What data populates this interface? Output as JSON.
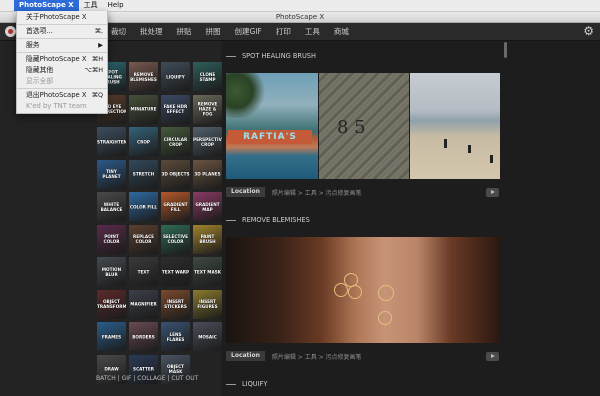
{
  "menubar": {
    "app": "PhotoScape X",
    "items": [
      "工具",
      "Help"
    ]
  },
  "window_title": "PhotoScape X",
  "toolbar": {
    "tabs": [
      "裁切",
      "批处理",
      "拼贴",
      "拼图",
      "创建GIF",
      "打印",
      "工具",
      "商城"
    ]
  },
  "app_menu": {
    "items": [
      {
        "label": "关于PhotoScape X",
        "shortcut": ""
      },
      {
        "label": "首选项...",
        "shortcut": "⌘,"
      },
      {
        "label": "服务",
        "shortcut": "▶"
      },
      {
        "label": "隐藏PhotoScape X",
        "shortcut": "⌘H"
      },
      {
        "label": "隐藏其他",
        "shortcut": "⌥⌘H"
      },
      {
        "label": "显示全部",
        "shortcut": ""
      },
      {
        "label": "退出PhotoScape X",
        "shortcut": "⌘Q"
      }
    ],
    "footer": "K'ed by TNT team"
  },
  "features": [
    {
      "label": "SPOT HEALING BRUSH",
      "color": "#2c6a74"
    },
    {
      "label": "REMOVE BLEMISHES",
      "color": "#7a5a50"
    },
    {
      "label": "LIQUIFY",
      "color": "#3f4d59"
    },
    {
      "label": "CLONE STAMP",
      "color": "#2f5e5c"
    },
    {
      "label": "RED EYE CORRECTION",
      "color": "#5a3e2c"
    },
    {
      "label": "MINIATURE",
      "color": "#46503a"
    },
    {
      "label": "FAKE HDR EFFECT",
      "color": "#3a4a64"
    },
    {
      "label": "REMOVE HAZE & FOG",
      "color": "#6c6858"
    },
    {
      "label": "STRAIGHTEN",
      "color": "#3d4e5e"
    },
    {
      "label": "CROP",
      "color": "#35627a"
    },
    {
      "label": "CIRCULAR CROP",
      "color": "#455a3c"
    },
    {
      "label": "PERSPECTIVE CROP",
      "color": "#52606c"
    },
    {
      "label": "TINY PLANET",
      "color": "#2b5a8a"
    },
    {
      "label": "STRETCH",
      "color": "#31495a"
    },
    {
      "label": "3D OBJECTS",
      "color": "#5a4b3a"
    },
    {
      "label": "3D PLANES",
      "color": "#6a5440"
    },
    {
      "label": "WHITE BALANCE",
      "color": "#4a4a4a"
    },
    {
      "label": "COLOR FILL",
      "color": "#2e6aa2"
    },
    {
      "label": "GRADIENT FILL",
      "color": "#b2582c"
    },
    {
      "label": "GRADIENT MAP",
      "color": "#8a3a64"
    },
    {
      "label": "POINT COLOR",
      "color": "#5a2a4a"
    },
    {
      "label": "REPLACE COLOR",
      "color": "#5a4030"
    },
    {
      "label": "SELECTIVE COLOR",
      "color": "#2f6a54"
    },
    {
      "label": "PAINT BRUSH",
      "color": "#a2842c"
    },
    {
      "label": "MOTION BLUR",
      "color": "#444a50"
    },
    {
      "label": "TEXT",
      "color": "#3a3a3a"
    },
    {
      "label": "TEXT WARP",
      "color": "#2d2d2d"
    },
    {
      "label": "TEXT MASK",
      "color": "#3e4a42"
    },
    {
      "label": "OBJECT TRANSFORM",
      "color": "#5c2a2a"
    },
    {
      "label": "MAGNIFIER",
      "color": "#3a3f48"
    },
    {
      "label": "INSERT STICKERS",
      "color": "#7a4a2c"
    },
    {
      "label": "INSERT FIGURES",
      "color": "#8a7a2c"
    },
    {
      "label": "FRAMES",
      "color": "#2a5e8a"
    },
    {
      "label": "BORDERS",
      "color": "#6a4a52"
    },
    {
      "label": "LENS FLARES",
      "color": "#3a5272"
    },
    {
      "label": "MOSAIC",
      "color": "#4a4e5a"
    },
    {
      "label": "DRAW",
      "color": "#4a4a4a"
    },
    {
      "label": "SCATTER",
      "color": "#2a3a56"
    },
    {
      "label": "OBJECT MASK",
      "color": "#485462"
    }
  ],
  "left_footer": "BATCH | GIF | COLLAGE | CUT OUT",
  "sections": [
    {
      "title": "SPOT HEALING BRUSH",
      "location_label": "Location",
      "path": "照片编辑 > 工具 > 污点修复画笔"
    },
    {
      "title": "REMOVE BLEMISHES",
      "location_label": "Location",
      "path": "照片编辑 > 工具 > 污点修复画笔"
    },
    {
      "title": "LIQUIFY"
    }
  ],
  "photo1_text": {
    "left": "RAFTIA'S",
    "mid": "8 5"
  }
}
